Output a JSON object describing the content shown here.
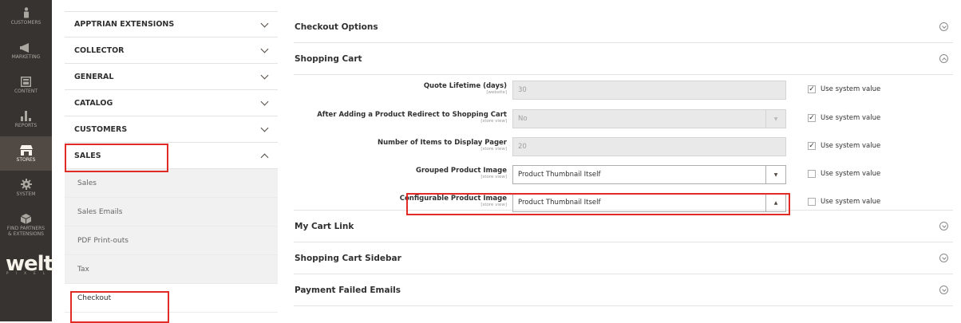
{
  "admin_nav": {
    "customers": "CUSTOMERS",
    "marketing": "MARKETING",
    "content": "CONTENT",
    "reports": "REPORTS",
    "stores": "STORES",
    "system": "SYSTEM",
    "partners_line1": "FIND PARTNERS",
    "partners_line2": "& EXTENSIONS",
    "logo": "welt",
    "logo_sub": "P I X E L"
  },
  "config_tabs": {
    "sections": [
      "APPTRIAN EXTENSIONS",
      "COLLECTOR",
      "GENERAL",
      "CATALOG",
      "CUSTOMERS"
    ],
    "expanded": "SALES",
    "subitems": [
      "Sales",
      "Sales Emails",
      "PDF Print-outs",
      "Tax"
    ],
    "active_subitem": "Checkout"
  },
  "groups": {
    "checkout_options": "Checkout Options",
    "shopping_cart": "Shopping Cart",
    "my_cart_link": "My Cart Link",
    "cart_sidebar": "Shopping Cart Sidebar",
    "payment_failed": "Payment Failed Emails"
  },
  "fields": [
    {
      "label": "Quote Lifetime (days)",
      "scope": "[website]",
      "value": "30",
      "use_system": "Use system value",
      "checked": true
    },
    {
      "label": "After Adding a Product Redirect to Shopping Cart",
      "scope": "[store view]",
      "value": "No",
      "use_system": "Use system value",
      "checked": true
    },
    {
      "label": "Number of Items to Display Pager",
      "scope": "[store view]",
      "value": "20",
      "use_system": "Use system value",
      "checked": true
    },
    {
      "label": "Grouped Product Image",
      "scope": "[store view]",
      "value": "Product Thumbnail Itself",
      "use_system": "Use system value",
      "checked": false
    },
    {
      "label": "Configurable Product Image",
      "scope": "[store view]",
      "value": "Product Thumbnail Itself",
      "use_system": "Use system value",
      "checked": false
    }
  ],
  "icons": {
    "check": "✓",
    "arrow_down": "▼",
    "arrow_up": "▲"
  },
  "colors": {
    "nav_bg": "#373330",
    "nav_active": "#514943",
    "highlight_red": "#e02b27"
  }
}
